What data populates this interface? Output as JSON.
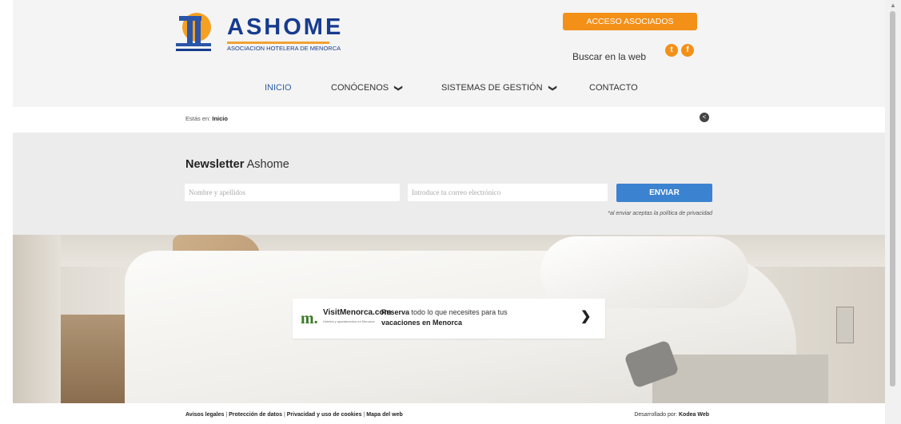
{
  "header": {
    "logo_word": "ASHOME",
    "logo_sub": "ASOCIACION HOTELERA DE MENORCA",
    "accesso_button": "ACCESO ASOCIADOS",
    "search_label": "Buscar en la web",
    "social": [
      {
        "icon": "twitter-icon",
        "glyph": "t"
      },
      {
        "icon": "facebook-icon",
        "glyph": "f"
      }
    ]
  },
  "nav": {
    "items": [
      {
        "label": "INICIO"
      },
      {
        "label": "CONÓCENOS",
        "chevron": "❯"
      },
      {
        "label": "SISTEMAS DE GESTIÓN",
        "chevron": "❯"
      },
      {
        "label": "CONTACTO"
      }
    ]
  },
  "breadcrumb": {
    "prefix": "Estás en:",
    "current": "Inicio",
    "share_glyph": "<"
  },
  "newsletter": {
    "title_bold": "Newsletter",
    "title_rest": "Ashome",
    "name_placeholder": "Nombre y apellidos",
    "email_placeholder": "Introduce tu correo electrónico",
    "submit": "ENVIAR",
    "privacy_note": "*al enviar aceptas la política de privacidad"
  },
  "promo": {
    "m_glyph": "m.",
    "brand": "VisitMenorca.com",
    "tagline": "Hoteles y apartamentos en Menorca",
    "text_bold1": "Reserva",
    "text_mid": "todo lo que necesites para tus",
    "text_bold2": "vacaciones en Menorca",
    "arrow": "❯"
  },
  "footer": {
    "links": [
      "Avisos legales",
      "Protección de datos",
      "Privacidad y uso de cookies",
      "Mapa del web"
    ],
    "separator": "|",
    "dev_prefix": "Desarrollado por:",
    "dev_name": "Kodea Web"
  },
  "colors": {
    "brand_blue": "#163c8f",
    "orange": "#f29018",
    "button_blue": "#3b82d0",
    "nav_active": "#2f5fa7"
  }
}
